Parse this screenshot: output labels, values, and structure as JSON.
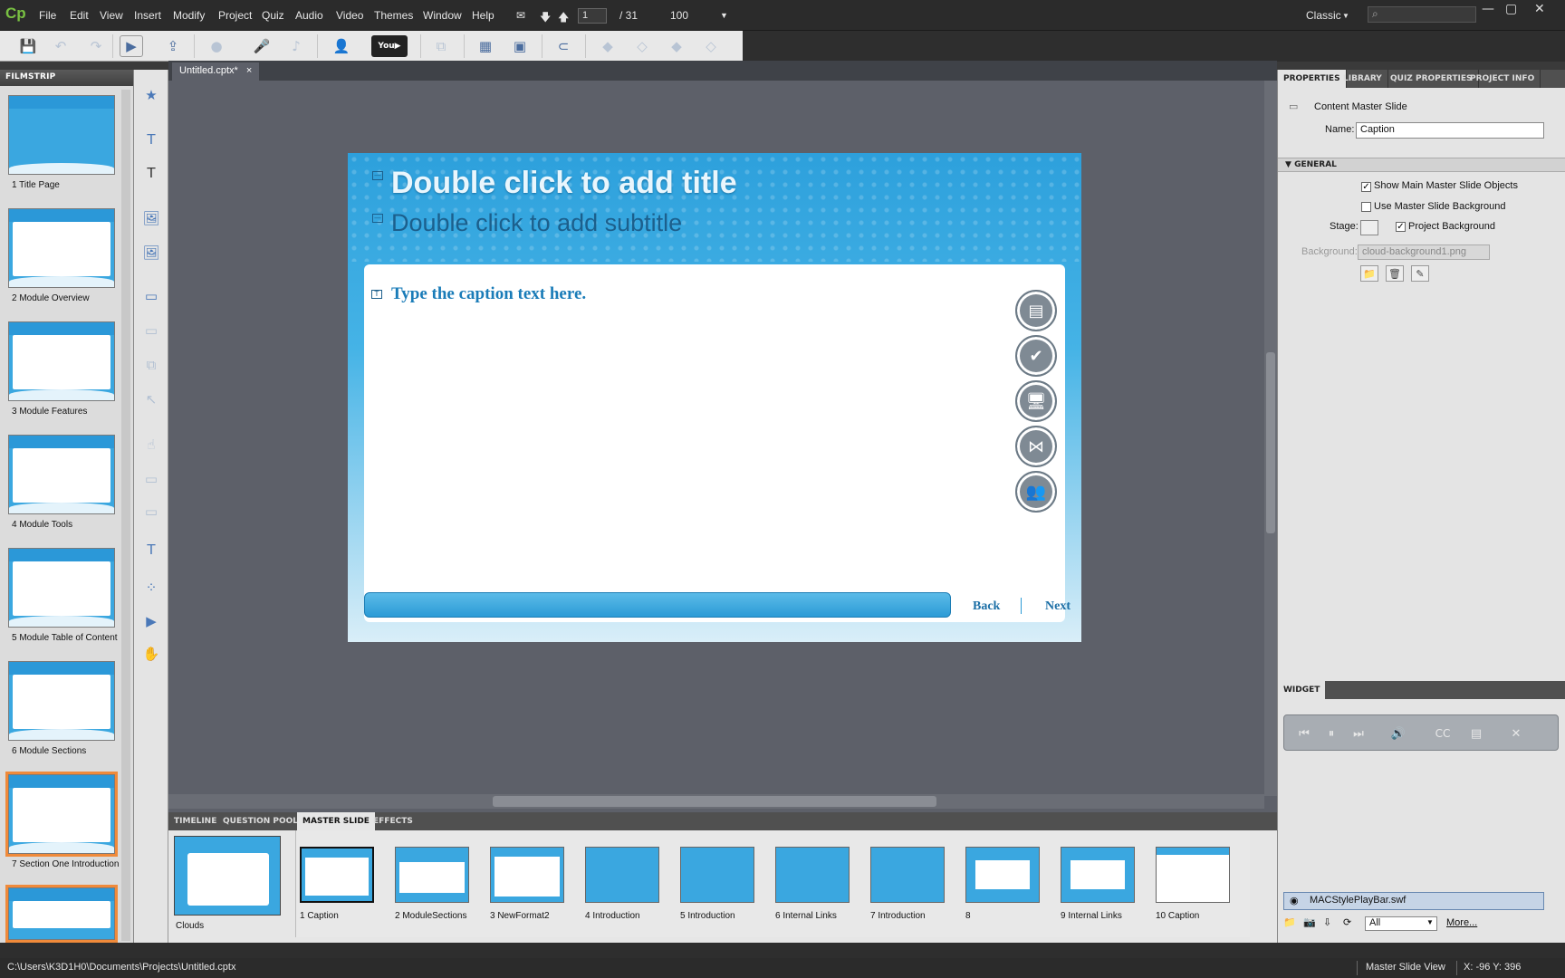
{
  "app": {
    "logo": "Cp",
    "workspace": "Classic"
  },
  "menu": [
    "File",
    "Edit",
    "View",
    "Insert",
    "Modify",
    "Project",
    "Quiz",
    "Audio",
    "Video",
    "Themes",
    "Window",
    "Help"
  ],
  "nav": {
    "current_slide": "1",
    "total": "/ 31",
    "zoom": "100"
  },
  "filmstrip": {
    "title": "FILMSTRIP",
    "slides": [
      {
        "label": "1 Title Page"
      },
      {
        "label": "2 Module Overview"
      },
      {
        "label": "3 Module Features"
      },
      {
        "label": "4 Module Tools"
      },
      {
        "label": "5 Module Table of Content"
      },
      {
        "label": "6 Module Sections"
      },
      {
        "label": "7 Section One Introduction"
      }
    ]
  },
  "document_tab": "Untitled.cptx*",
  "slide": {
    "title": "Double click to add title",
    "subtitle": "Double click to add subtitle",
    "caption": "Type the caption text here.",
    "back": "Back",
    "next": "Next"
  },
  "bottom_tabs": [
    "TIMELINE",
    "QUESTION POOL",
    "MASTER SLIDE",
    "EFFECTS"
  ],
  "master": {
    "main_label": "Clouds",
    "layouts": [
      "1 Caption",
      "2 ModuleSections",
      "3 NewFormat2",
      "4 Introduction",
      "5 Introduction",
      "6 Internal Links",
      "7 Introduction",
      "8",
      "9 Internal Links",
      "10 Caption"
    ]
  },
  "properties": {
    "tabs": [
      "PROPERTIES",
      "LIBRARY",
      "QUIZ PROPERTIES",
      "PROJECT INFO"
    ],
    "type": "Content Master Slide",
    "name_label": "Name:",
    "name_value": "Caption",
    "general": "GENERAL",
    "show_main": "Show Main Master Slide Objects",
    "use_bg": "Use Master Slide Background",
    "stage": "Stage:",
    "project_bg": "Project Background",
    "bg_label": "Background:",
    "bg_value": "cloud-background1.png"
  },
  "widget": {
    "tab": "WIDGET",
    "cc": "CC",
    "item": "MACStylePlayBar.swf",
    "filter": "All",
    "more": "More..."
  },
  "status": {
    "path": "C:\\Users\\K3D1H0\\Documents\\Projects\\Untitled.cptx",
    "view": "Master Slide View",
    "coords": "X: -96 Y: 396"
  }
}
